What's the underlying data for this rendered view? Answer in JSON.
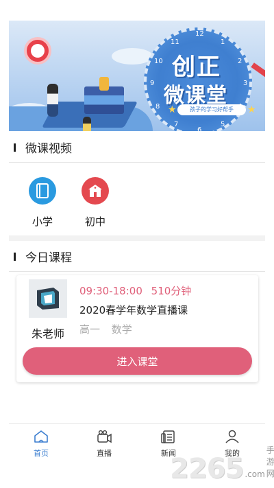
{
  "banner": {
    "title_line1": "创正",
    "title_line2": "微课堂",
    "tagline": "孩子的学习好帮手",
    "clock_numbers": [
      "12",
      "1",
      "2",
      "3",
      "4",
      "5",
      "6",
      "7",
      "8",
      "9",
      "10",
      "11"
    ]
  },
  "micro_video": {
    "header": "微课视频",
    "categories": [
      {
        "label": "小学",
        "icon": "book-icon",
        "color": "#2a9ae0"
      },
      {
        "label": "初中",
        "icon": "school-icon",
        "color": "#e4494f"
      }
    ]
  },
  "today_courses": {
    "header": "今日课程",
    "course": {
      "time": "09:30-18:00",
      "duration": "510分钟",
      "title": "2020春学年数学直播课",
      "grade": "高一",
      "subject": "数学",
      "teacher": "朱老师",
      "enter_label": "进入课堂"
    }
  },
  "tabbar": {
    "tabs": [
      {
        "label": "首页",
        "icon": "home-icon",
        "active": true
      },
      {
        "label": "直播",
        "icon": "camera-icon",
        "active": false
      },
      {
        "label": "新闻",
        "icon": "news-icon",
        "active": false
      },
      {
        "label": "我的",
        "icon": "user-icon",
        "active": false
      }
    ]
  },
  "watermark": {
    "number": "2265",
    "domain_suffix": ".com",
    "text": "手游网"
  },
  "colors": {
    "accent": "#e0607a",
    "tab_active": "#3d7fd0",
    "primary_blue": "#2a9ae0",
    "red": "#e4494f"
  }
}
